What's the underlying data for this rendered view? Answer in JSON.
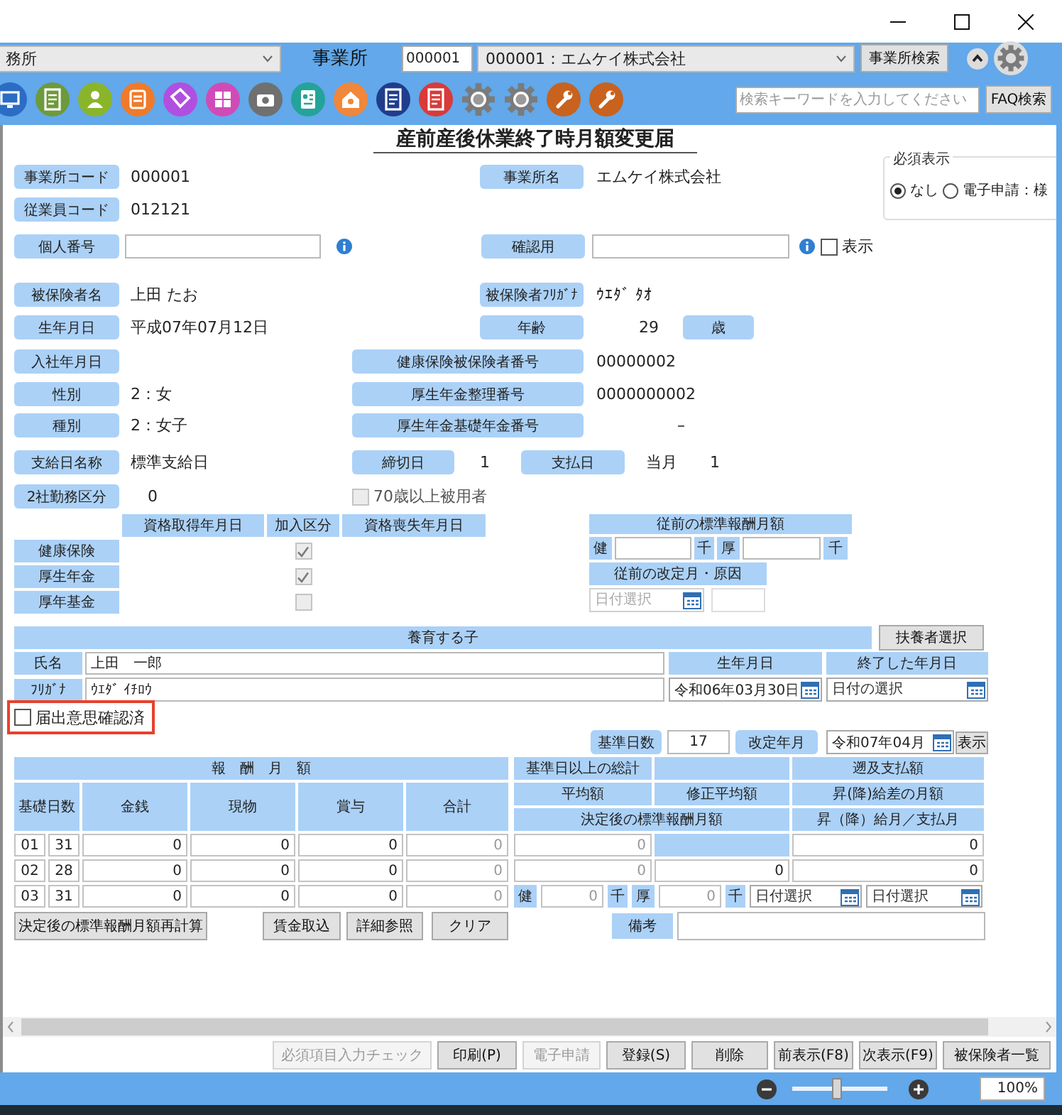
{
  "toolbar": {
    "module_select": "務所",
    "office_label": "事業所",
    "office_code": "000001",
    "office_name": "000001：エムケイ株式会社",
    "office_search_button": "事業所検索",
    "search_placeholder": "検索キーワードを入力してください",
    "faq_button": "FAQ検索"
  },
  "form": {
    "title": "産前産後休業終了時月額変更届",
    "required_display": {
      "legend": "必須表示",
      "options": [
        {
          "label": "なし",
          "selected": true
        },
        {
          "label": "電子申請：様",
          "selected": false
        }
      ]
    },
    "office_code": {
      "label": "事業所コード",
      "value": "000001"
    },
    "office_name": {
      "label": "事業所名",
      "value": "エムケイ株式会社"
    },
    "employee_code": {
      "label": "従業員コード",
      "value": "012121"
    },
    "my_number": {
      "label": "個人番号"
    },
    "confirm": {
      "label": "確認用",
      "show_label": "表示",
      "show_checked": false
    },
    "insured_name": {
      "label": "被保険者名",
      "value": "上田 たお"
    },
    "insured_kana": {
      "label": "被保険者ﾌﾘｶﾞﾅ",
      "value": "ｳｴﾀﾞ ﾀｵ"
    },
    "birth_date": {
      "label": "生年月日",
      "value": "平成07年07月12日"
    },
    "age": {
      "label": "年齢",
      "value": "29",
      "unit": "歳"
    },
    "hire_date": {
      "label": "入社年月日"
    },
    "health_number": {
      "label": "健康保険被保険者番号",
      "value": "00000002"
    },
    "gender": {
      "label": "性別",
      "value": "2：女"
    },
    "pension_number": {
      "label": "厚生年金整理番号",
      "value": "0000000002"
    },
    "type": {
      "label": "種別",
      "value": "2：女子"
    },
    "basic_pension_number": {
      "label": "厚生年金基礎年金番号",
      "value": "–"
    },
    "pay_day_name": {
      "label": "支給日名称",
      "value": "標準支給日"
    },
    "closing_day": {
      "label": "締切日",
      "value": "1"
    },
    "pay_day": {
      "label": "支払日",
      "month": "当月",
      "value": "1"
    },
    "dual_work": {
      "label": "2社勤務区分",
      "value": "0"
    },
    "over70": {
      "label": "70歳以上被用者",
      "checked": false,
      "disabled": true
    },
    "qualification": {
      "columns": [
        "資格取得年月日",
        "加入区分",
        "資格喪失年月日"
      ],
      "rows": [
        {
          "label": "健康保険",
          "checked": true,
          "disabled": true
        },
        {
          "label": "厚生年金",
          "checked": true,
          "disabled": true
        },
        {
          "label": "厚年基金",
          "checked": false,
          "disabled": true
        }
      ]
    },
    "previous": {
      "title": "従前の標準報酬月額",
      "health_label": "健",
      "health_unit": "千",
      "pension_label": "厚",
      "pension_unit": "千",
      "revision_title": "従前の改定月・原因",
      "revision_placeholder": "日付選択"
    },
    "child": {
      "title": "養育する子",
      "select_button": "扶養者選択",
      "name_label": "氏名",
      "name": "上田　一郎",
      "kana_label": "ﾌﾘｶﾞﾅ",
      "kana": "ｳｴﾀﾞ ｲﾁﾛｳ",
      "birth_label": "生年月日",
      "birth": "令和06年03月30日",
      "end_label": "終了した年月日",
      "end_placeholder": "日付の選択"
    },
    "intent_confirmed": {
      "label": "届出意思確認済",
      "checked": false
    },
    "base_days": {
      "label": "基準日数",
      "value": "17"
    },
    "revision_month": {
      "label": "改定年月",
      "value": "令和07年04月",
      "show_button": "表示"
    },
    "remuneration": {
      "title": "報　酬　月　額",
      "columns": [
        "基礎日数",
        "金銭",
        "現物",
        "賞与",
        "合計"
      ],
      "rows": [
        {
          "month": "01",
          "days": "31",
          "cash": "0",
          "goods": "0",
          "bonus": "0",
          "total": "0"
        },
        {
          "month": "02",
          "days": "28",
          "cash": "0",
          "goods": "0",
          "bonus": "0",
          "total": "0"
        },
        {
          "month": "03",
          "days": "31",
          "cash": "0",
          "goods": "0",
          "bonus": "0",
          "total": "0"
        }
      ]
    },
    "summary": {
      "total_label": "基準日以上の総計",
      "retro_label": "遡及支払額",
      "average_label": "平均額",
      "corrected_label": "修正平均額",
      "diff_label": "昇(降)給差の月額",
      "decided_label": "決定後の標準報酬月額",
      "month_label": "昇（降）給月／支払月",
      "total": "0",
      "retro": "0",
      "average": "0",
      "corrected": "0",
      "diff": "0",
      "decided_health_label": "健",
      "decided_health": "0",
      "decided_health_unit": "千",
      "decided_pension_label": "厚",
      "decided_pension": "0",
      "decided_pension_unit": "千",
      "raise_month_placeholder": "日付選択",
      "pay_month_placeholder": "日付選択"
    },
    "actions": {
      "recalc": "決定後の標準報酬月額再計算",
      "wage_import": "賃金取込",
      "details": "詳細参照",
      "clear": "クリア",
      "remarks_label": "備考"
    }
  },
  "footer_buttons": [
    {
      "label": "必須項目入力チェック",
      "disabled": true
    },
    {
      "label": "印刷(P)",
      "disabled": false
    },
    {
      "label": "電子申請",
      "disabled": true
    },
    {
      "label": "登録(S)",
      "disabled": false
    },
    {
      "label": "削除",
      "disabled": false
    },
    {
      "label": "前表示(F8)",
      "disabled": false
    },
    {
      "label": "次表示(F9)",
      "disabled": false
    },
    {
      "label": "被保険者一覧",
      "disabled": false
    }
  ],
  "zoom": {
    "level": 0.47,
    "reading": "100%"
  }
}
